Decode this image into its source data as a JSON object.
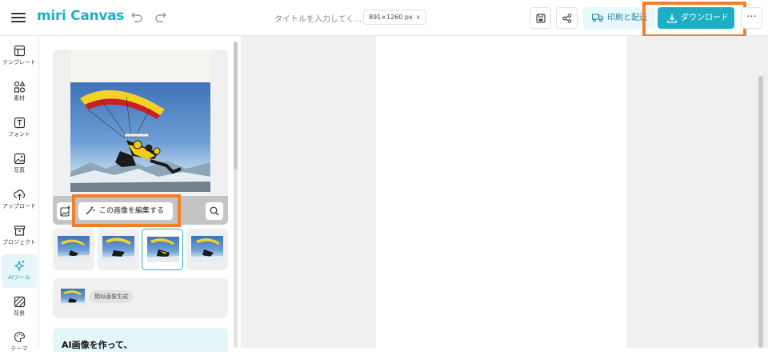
{
  "header": {
    "logo": "miri Canvas",
    "title_placeholder": "タイトルを入力してく...",
    "size_chip": "891×1260 px",
    "print_label": "印刷と配送",
    "download_label": "ダウンロード",
    "more_label": "···"
  },
  "sidebar": {
    "items": [
      {
        "label": "テンプレート",
        "icon": "template-icon"
      },
      {
        "label": "素材",
        "icon": "elements-icon"
      },
      {
        "label": "フォント",
        "icon": "font-icon"
      },
      {
        "label": "写真",
        "icon": "photo-icon"
      },
      {
        "label": "アップロード",
        "icon": "upload-icon"
      },
      {
        "label": "プロジェクト",
        "icon": "project-icon"
      },
      {
        "label": "AIツール",
        "icon": "ai-sparkle-icon",
        "active": true
      },
      {
        "label": "背景",
        "icon": "background-icon"
      },
      {
        "label": "テーマ",
        "icon": "theme-icon"
      }
    ]
  },
  "panel": {
    "edit_button_label": "この画像を編集する",
    "similar_label": "類似画像生成",
    "promo_heading": "AI画像を作って、",
    "selected_thumbnail_index": 2,
    "thumbnail_count": 4
  },
  "colors": {
    "accent": "#1caec2",
    "highlight": "#f47f2b",
    "ai_active_bg": "#e6f6f8",
    "workspace_bg": "#f0f0f0"
  }
}
